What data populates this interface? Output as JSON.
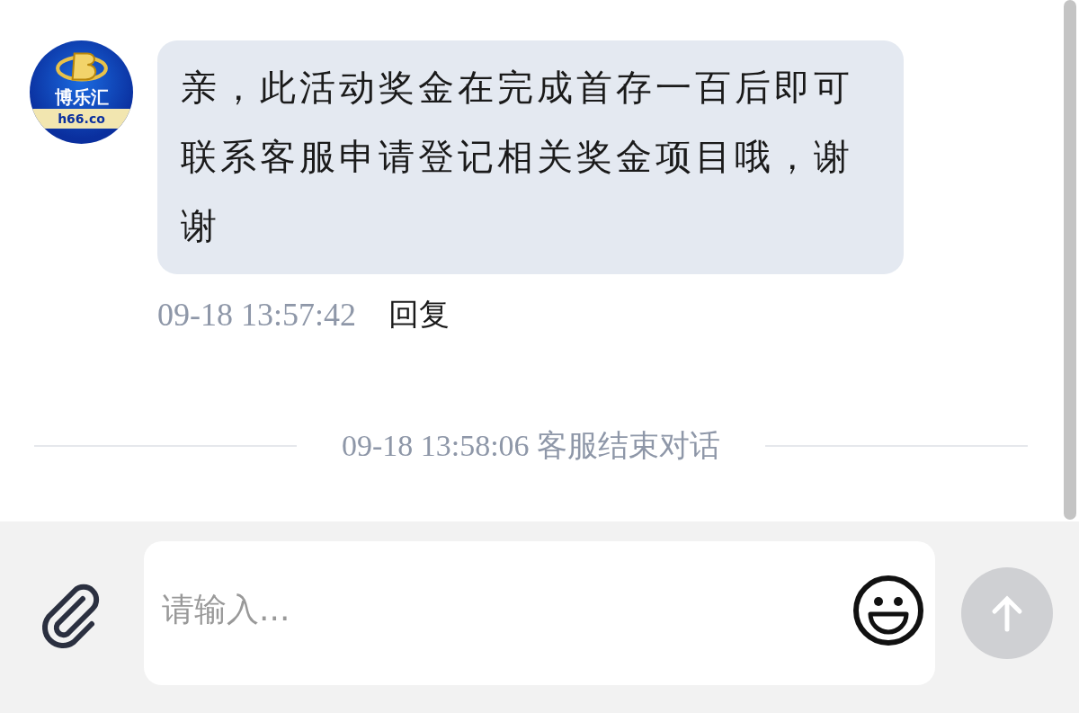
{
  "messages": [
    {
      "kind": "agent",
      "avatar": {
        "logo_text": "博乐汇",
        "domain": "h66.co"
      },
      "text": "亲，此活动奖金在完成首存一百后即可联系客服申请登记相关奖金项目哦，谢谢",
      "time": "09-18 13:57:42",
      "action": "回复"
    },
    {
      "kind": "system",
      "time": "09-18 13:58:06",
      "text": "客服结束对话"
    }
  ],
  "input": {
    "placeholder": "请输入..."
  },
  "send_button": {
    "disabled": true
  }
}
